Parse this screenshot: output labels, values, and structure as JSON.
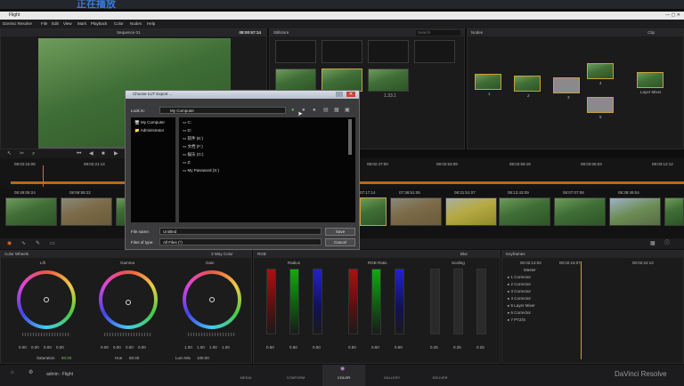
{
  "banner": {
    "title": "正在播放"
  },
  "window": {
    "title": "Flight"
  },
  "menu": [
    "DaVinci Resolve",
    "File",
    "Edit",
    "View",
    "Mark",
    "Playback",
    "Color",
    "Nodes",
    "Help"
  ],
  "viewer": {
    "clip_label": "Sequence 01",
    "timecode": "08:00:57:14"
  },
  "gallery": {
    "title": "Stillstore",
    "search_placeholder": "Search",
    "still_label": "1.33.1"
  },
  "nodes": {
    "title": "Nodes",
    "mode": "Clip",
    "layer_mixer": "Layer Mixer",
    "numbers": [
      "1",
      "2",
      "3",
      "4",
      "5"
    ]
  },
  "timeline": {
    "ruler": [
      "08:02:15:05",
      "08:02:21:14",
      "08:02:47:00",
      "08:02:53:09",
      "08:02:59:18",
      "08:03:06:03",
      "08:03:12:12"
    ]
  },
  "clips": [
    {
      "tc": "08:48:09:24",
      "style": "green"
    },
    {
      "tc": "08:59:59:22",
      "style": "brown"
    },
    {
      "tc": "",
      "style": "green"
    },
    {
      "tc": "07:17:14",
      "style": "green"
    },
    {
      "tc": "07:38:51:05",
      "style": "brown"
    },
    {
      "tc": "08:31:51:07",
      "style": "yellow"
    },
    {
      "tc": "08:13:43:09",
      "style": "green"
    },
    {
      "tc": "08:07:07:08",
      "style": "green"
    },
    {
      "tc": "08:38:49:04",
      "style": "road"
    },
    {
      "tc": "",
      "style": "green"
    }
  ],
  "dialog": {
    "title": "Choose LUT Export ...",
    "look_in_label": "Look in:",
    "look_in_value": "My Computer",
    "places": [
      "My Computer",
      "Administrator"
    ],
    "drives": [
      "C:",
      "D:",
      "软件 (E:)",
      "文档 (F:)",
      "娱乐 (G:)",
      "Z:",
      "My Password (S:)"
    ],
    "file_name_label": "File name:",
    "file_name_value": "Untitled",
    "file_type_label": "Files of type:",
    "file_type_value": "All Files (*)",
    "save": "Save",
    "cancel": "Cancel"
  },
  "color": {
    "panel_title": "Color Wheels",
    "mode": "3 Way Color",
    "wheels": [
      {
        "label": "Lift",
        "values": [
          "0.00",
          "0.00",
          "0.00",
          "0.00"
        ]
      },
      {
        "label": "Gamma",
        "values": [
          "0.00",
          "0.00",
          "0.00",
          "0.00"
        ]
      },
      {
        "label": "Gain",
        "values": [
          "1.00",
          "1.00",
          "1.00",
          "1.00"
        ]
      }
    ],
    "footer": {
      "saturation_label": "Saturation",
      "saturation_value": "50.00",
      "hue_label": "Hue",
      "hue_value": "50.00",
      "lum_label": "Lum Mix",
      "lum_value": "100.00"
    },
    "rgb": {
      "title": "RGB",
      "label": "Radius",
      "values": [
        "0.50",
        "0.50",
        "0.50"
      ]
    },
    "rgb2": {
      "label": "RGB Ratio",
      "values": [
        "0.50",
        "0.50",
        "0.50"
      ]
    },
    "scaling": {
      "label": "Scaling",
      "values": [
        "0.25",
        "0.25",
        "0.25"
      ]
    },
    "blur": "Blur",
    "keyframes": {
      "title": "Keyframes",
      "tc1": "00:02:13:03",
      "tc2": "00:02:15:07",
      "tc3": "00:02:24:13",
      "master": "Master",
      "rows": [
        "Corrector",
        "Corrector",
        "Corrector",
        "Corrector",
        "Layer Mixer",
        "Corrector",
        "PTZ/S"
      ]
    }
  },
  "footer": {
    "user": "admin : Flight",
    "tabs": [
      "MEDIA",
      "CONFORM",
      "COLOR",
      "GALLERY",
      "DELIVER"
    ],
    "brand": "DaVinci Resolve"
  },
  "colors": {
    "accent": "#c9a13b",
    "dialog": "#3b3b3d",
    "bg": "#0e0e0f"
  }
}
